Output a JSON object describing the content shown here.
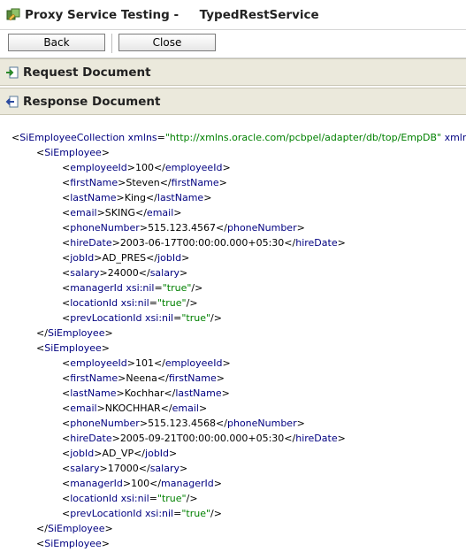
{
  "window": {
    "title": "Proxy Service Testing -     TypedRestService"
  },
  "toolbar": {
    "back_label": "Back",
    "close_label": "Close"
  },
  "sections": {
    "request_label": "Request Document",
    "response_label": "Response Document"
  },
  "colors": {
    "section_bg": "#ebe9dc",
    "tag": "#000080",
    "attr_value": "#008000"
  },
  "xml": {
    "root_open_name": "SiEmployeeCollection",
    "root_attr_name": "xmlns",
    "root_attr_value": "\"http://xmlns.oracle.com/pcbpel/adapter/db/top/EmpDB\"",
    "root_attr2_name": "xmlns",
    "employees": [
      {
        "employeeId": "100",
        "firstName": "Steven",
        "lastName": "King",
        "email": "SKING",
        "phoneNumber": "515.123.4567",
        "hireDate": "2003-06-17T00:00:00.000+05:30",
        "jobId": "AD_PRES",
        "salary": "24000",
        "managerId_nil": "\"true\"",
        "locationId_nil": "\"true\"",
        "prevLocationId_nil": "\"true\""
      },
      {
        "employeeId": "101",
        "firstName": "Neena",
        "lastName": "Kochhar",
        "email": "NKOCHHAR",
        "phoneNumber": "515.123.4568",
        "hireDate": "2005-09-21T00:00:00.000+05:30",
        "jobId": "AD_VP",
        "salary": "17000",
        "managerId": "100",
        "locationId_nil": "\"true\"",
        "prevLocationId_nil": "\"true\""
      }
    ],
    "nil_attr": "xsi:nil",
    "employee_tag": "SiEmployee"
  }
}
